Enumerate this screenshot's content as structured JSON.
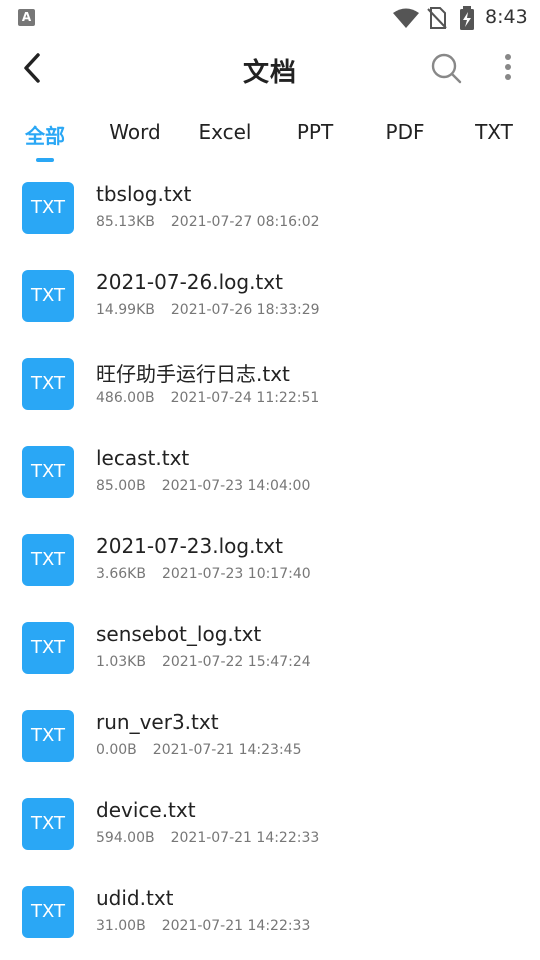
{
  "status_bar": {
    "notification_glyph": "A",
    "time": "8:43"
  },
  "header": {
    "title": "文档"
  },
  "tabs": [
    {
      "label": "全部",
      "active": true
    },
    {
      "label": "Word",
      "active": false
    },
    {
      "label": "Excel",
      "active": false
    },
    {
      "label": "PPT",
      "active": false
    },
    {
      "label": "PDF",
      "active": false
    },
    {
      "label": "TXT",
      "active": false
    }
  ],
  "files": [
    {
      "icon_label": "TXT",
      "name": "tbslog.txt",
      "size": "85.13KB",
      "date": "2021-07-27 08:16:02"
    },
    {
      "icon_label": "TXT",
      "name": "2021-07-26.log.txt",
      "size": "14.99KB",
      "date": "2021-07-26 18:33:29"
    },
    {
      "icon_label": "TXT",
      "name": "旺仔助手运行日志.txt",
      "size": "486.00B",
      "date": "2021-07-24 11:22:51"
    },
    {
      "icon_label": "TXT",
      "name": "lecast.txt",
      "size": "85.00B",
      "date": "2021-07-23 14:04:00"
    },
    {
      "icon_label": "TXT",
      "name": "2021-07-23.log.txt",
      "size": "3.66KB",
      "date": "2021-07-23 10:17:40"
    },
    {
      "icon_label": "TXT",
      "name": "sensebot_log.txt",
      "size": "1.03KB",
      "date": "2021-07-22 15:47:24"
    },
    {
      "icon_label": "TXT",
      "name": "run_ver3.txt",
      "size": "0.00B",
      "date": "2021-07-21 14:23:45"
    },
    {
      "icon_label": "TXT",
      "name": "device.txt",
      "size": "594.00B",
      "date": "2021-07-21 14:22:33"
    },
    {
      "icon_label": "TXT",
      "name": "udid.txt",
      "size": "31.00B",
      "date": "2021-07-21 14:22:33"
    }
  ],
  "colors": {
    "accent": "#2aa7f5"
  }
}
